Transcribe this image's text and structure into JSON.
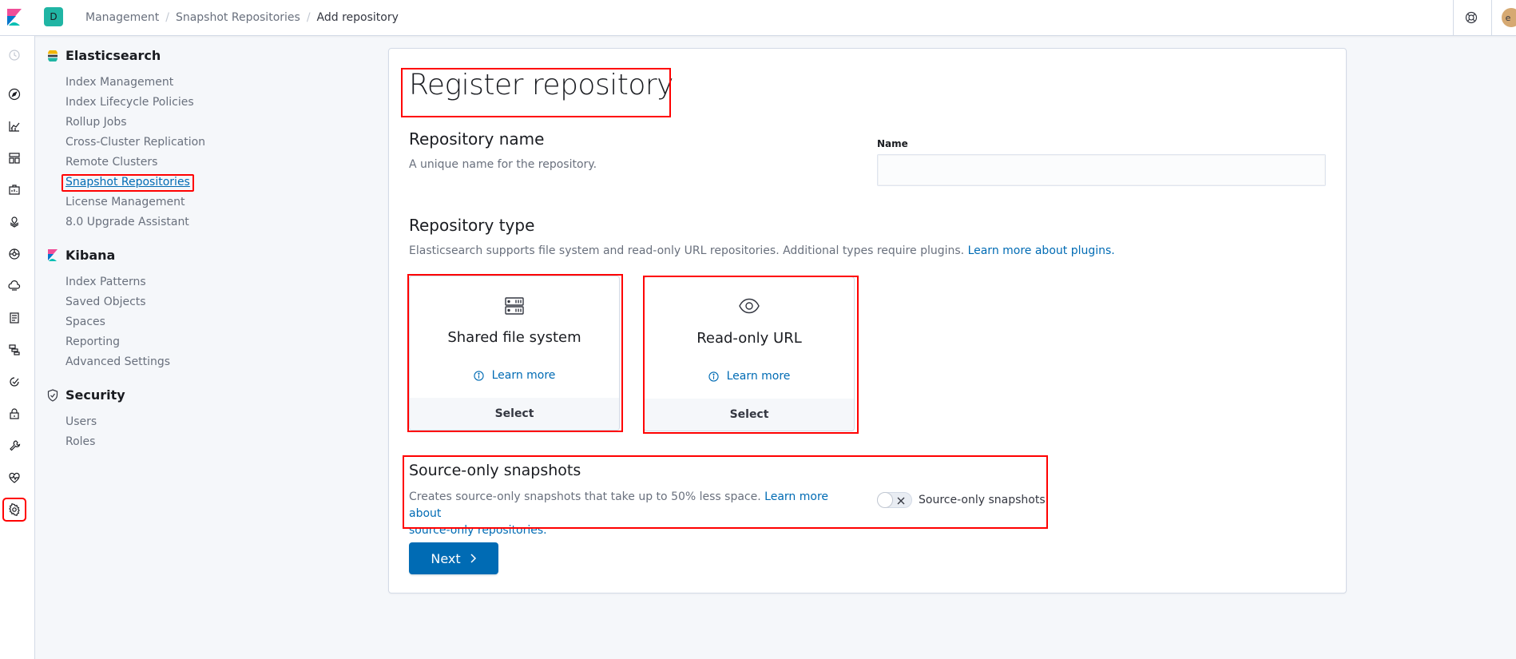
{
  "header": {
    "space_initial": "D",
    "breadcrumbs": [
      "Management",
      "Snapshot Repositories",
      "Add repository"
    ],
    "user_initial": "e"
  },
  "sidenav": {
    "groups": [
      {
        "title": "Elasticsearch",
        "items": [
          "Index Management",
          "Index Lifecycle Policies",
          "Rollup Jobs",
          "Cross-Cluster Replication",
          "Remote Clusters",
          "Snapshot Repositories",
          "License Management",
          "8.0 Upgrade Assistant"
        ]
      },
      {
        "title": "Kibana",
        "items": [
          "Index Patterns",
          "Saved Objects",
          "Spaces",
          "Reporting",
          "Advanced Settings"
        ]
      },
      {
        "title": "Security",
        "items": [
          "Users",
          "Roles"
        ]
      }
    ],
    "active_item": "Snapshot Repositories"
  },
  "main": {
    "title": "Register repository",
    "repo_name": {
      "title": "Repository name",
      "desc": "A unique name for the repository.",
      "field_label": "Name",
      "value": ""
    },
    "repo_type": {
      "title": "Repository type",
      "desc": "Elasticsearch supports file system and read-only URL repositories. Additional types require plugins.",
      "link": "Learn more about plugins.",
      "cards": [
        {
          "title": "Shared file system",
          "learn_more": "Learn more",
          "select": "Select"
        },
        {
          "title": "Read-only URL",
          "learn_more": "Learn more",
          "select": "Select"
        }
      ]
    },
    "source_only": {
      "title": "Source-only snapshots",
      "desc": "Creates source-only snapshots that take up to 50% less space.",
      "link_line1": "Learn more about",
      "link_line2": "source-only repositories.",
      "toggle_label": "Source-only snapshots",
      "toggle_on": false
    },
    "next_label": "Next"
  },
  "colors": {
    "accent": "#006bb4",
    "highlight": "#ff0000",
    "space_badge": "#20b5a4"
  }
}
